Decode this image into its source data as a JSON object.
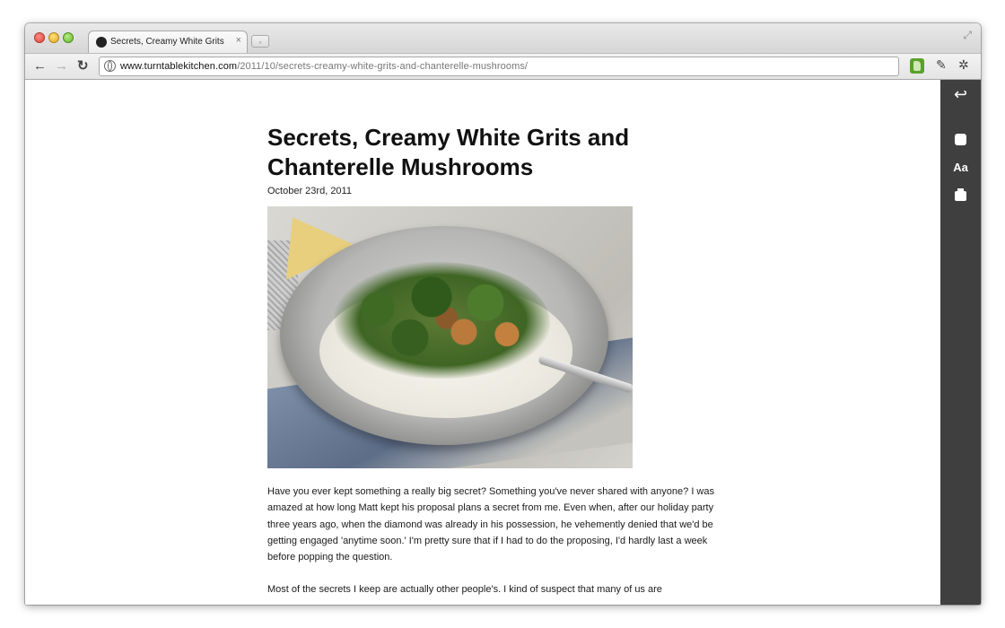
{
  "browser": {
    "tab_title": "Secrets, Creamy White Grits",
    "tab_close": "×",
    "url_host": "www.turntablekitchen.com",
    "url_path": "/2011/10/secrets-creamy-white-grits-and-chanterelle-mushrooms/",
    "icons": [
      "back-arrow-icon",
      "forward-arrow-icon",
      "reload-icon",
      "globe-icon",
      "evernote-icon",
      "clip-icon",
      "wrench-icon"
    ]
  },
  "sidebar": {
    "back_icon": "↩",
    "font_label": "Aa",
    "icons": [
      "back-icon",
      "evernote-icon",
      "font-size-icon",
      "print-icon"
    ],
    "background": "#3f3f3f"
  },
  "article": {
    "title": "Secrets, Creamy White Grits and Chanterelle Mushrooms",
    "date": "October 23rd, 2011",
    "paragraphs": [
      "Have you ever kept something a really big secret? Something you've never shared with anyone? I was amazed at how long Matt kept his proposal plans a secret from me. Even when, after our holiday party three years ago, when the diamond was already in his possession, he vehemently denied that we'd be getting engaged 'anytime soon.' I'm pretty sure that if I had to do the proposing, I'd hardly last a week before popping the question.",
      "Most of the secrets I keep are actually other people's. I kind of suspect that many of us are"
    ]
  }
}
